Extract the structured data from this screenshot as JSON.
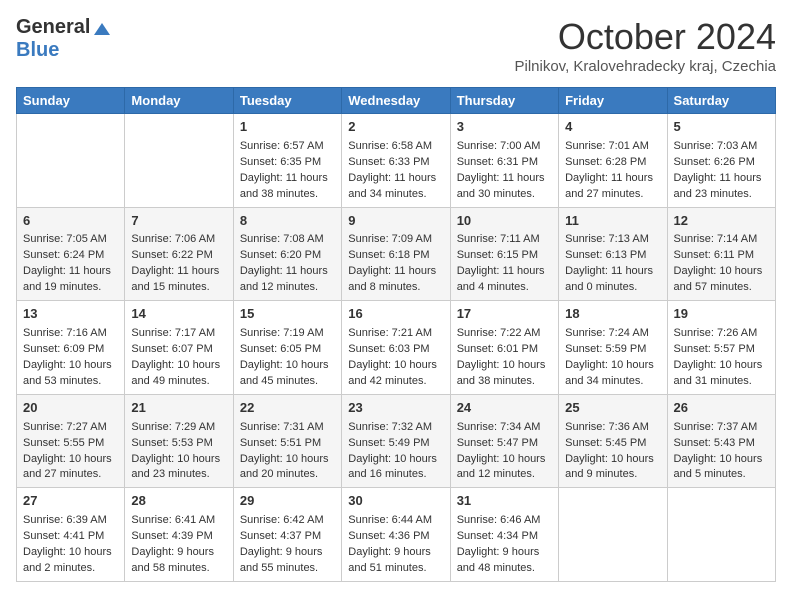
{
  "header": {
    "logo_general": "General",
    "logo_blue": "Blue",
    "month_title": "October 2024",
    "location": "Pilnikov, Kralovehradecky kraj, Czechia"
  },
  "days_of_week": [
    "Sunday",
    "Monday",
    "Tuesday",
    "Wednesday",
    "Thursday",
    "Friday",
    "Saturday"
  ],
  "weeks": [
    [
      {
        "day": "",
        "content": ""
      },
      {
        "day": "",
        "content": ""
      },
      {
        "day": "1",
        "content": "Sunrise: 6:57 AM\nSunset: 6:35 PM\nDaylight: 11 hours and 38 minutes."
      },
      {
        "day": "2",
        "content": "Sunrise: 6:58 AM\nSunset: 6:33 PM\nDaylight: 11 hours and 34 minutes."
      },
      {
        "day": "3",
        "content": "Sunrise: 7:00 AM\nSunset: 6:31 PM\nDaylight: 11 hours and 30 minutes."
      },
      {
        "day": "4",
        "content": "Sunrise: 7:01 AM\nSunset: 6:28 PM\nDaylight: 11 hours and 27 minutes."
      },
      {
        "day": "5",
        "content": "Sunrise: 7:03 AM\nSunset: 6:26 PM\nDaylight: 11 hours and 23 minutes."
      }
    ],
    [
      {
        "day": "6",
        "content": "Sunrise: 7:05 AM\nSunset: 6:24 PM\nDaylight: 11 hours and 19 minutes."
      },
      {
        "day": "7",
        "content": "Sunrise: 7:06 AM\nSunset: 6:22 PM\nDaylight: 11 hours and 15 minutes."
      },
      {
        "day": "8",
        "content": "Sunrise: 7:08 AM\nSunset: 6:20 PM\nDaylight: 11 hours and 12 minutes."
      },
      {
        "day": "9",
        "content": "Sunrise: 7:09 AM\nSunset: 6:18 PM\nDaylight: 11 hours and 8 minutes."
      },
      {
        "day": "10",
        "content": "Sunrise: 7:11 AM\nSunset: 6:15 PM\nDaylight: 11 hours and 4 minutes."
      },
      {
        "day": "11",
        "content": "Sunrise: 7:13 AM\nSunset: 6:13 PM\nDaylight: 11 hours and 0 minutes."
      },
      {
        "day": "12",
        "content": "Sunrise: 7:14 AM\nSunset: 6:11 PM\nDaylight: 10 hours and 57 minutes."
      }
    ],
    [
      {
        "day": "13",
        "content": "Sunrise: 7:16 AM\nSunset: 6:09 PM\nDaylight: 10 hours and 53 minutes."
      },
      {
        "day": "14",
        "content": "Sunrise: 7:17 AM\nSunset: 6:07 PM\nDaylight: 10 hours and 49 minutes."
      },
      {
        "day": "15",
        "content": "Sunrise: 7:19 AM\nSunset: 6:05 PM\nDaylight: 10 hours and 45 minutes."
      },
      {
        "day": "16",
        "content": "Sunrise: 7:21 AM\nSunset: 6:03 PM\nDaylight: 10 hours and 42 minutes."
      },
      {
        "day": "17",
        "content": "Sunrise: 7:22 AM\nSunset: 6:01 PM\nDaylight: 10 hours and 38 minutes."
      },
      {
        "day": "18",
        "content": "Sunrise: 7:24 AM\nSunset: 5:59 PM\nDaylight: 10 hours and 34 minutes."
      },
      {
        "day": "19",
        "content": "Sunrise: 7:26 AM\nSunset: 5:57 PM\nDaylight: 10 hours and 31 minutes."
      }
    ],
    [
      {
        "day": "20",
        "content": "Sunrise: 7:27 AM\nSunset: 5:55 PM\nDaylight: 10 hours and 27 minutes."
      },
      {
        "day": "21",
        "content": "Sunrise: 7:29 AM\nSunset: 5:53 PM\nDaylight: 10 hours and 23 minutes."
      },
      {
        "day": "22",
        "content": "Sunrise: 7:31 AM\nSunset: 5:51 PM\nDaylight: 10 hours and 20 minutes."
      },
      {
        "day": "23",
        "content": "Sunrise: 7:32 AM\nSunset: 5:49 PM\nDaylight: 10 hours and 16 minutes."
      },
      {
        "day": "24",
        "content": "Sunrise: 7:34 AM\nSunset: 5:47 PM\nDaylight: 10 hours and 12 minutes."
      },
      {
        "day": "25",
        "content": "Sunrise: 7:36 AM\nSunset: 5:45 PM\nDaylight: 10 hours and 9 minutes."
      },
      {
        "day": "26",
        "content": "Sunrise: 7:37 AM\nSunset: 5:43 PM\nDaylight: 10 hours and 5 minutes."
      }
    ],
    [
      {
        "day": "27",
        "content": "Sunrise: 6:39 AM\nSunset: 4:41 PM\nDaylight: 10 hours and 2 minutes."
      },
      {
        "day": "28",
        "content": "Sunrise: 6:41 AM\nSunset: 4:39 PM\nDaylight: 9 hours and 58 minutes."
      },
      {
        "day": "29",
        "content": "Sunrise: 6:42 AM\nSunset: 4:37 PM\nDaylight: 9 hours and 55 minutes."
      },
      {
        "day": "30",
        "content": "Sunrise: 6:44 AM\nSunset: 4:36 PM\nDaylight: 9 hours and 51 minutes."
      },
      {
        "day": "31",
        "content": "Sunrise: 6:46 AM\nSunset: 4:34 PM\nDaylight: 9 hours and 48 minutes."
      },
      {
        "day": "",
        "content": ""
      },
      {
        "day": "",
        "content": ""
      }
    ]
  ]
}
